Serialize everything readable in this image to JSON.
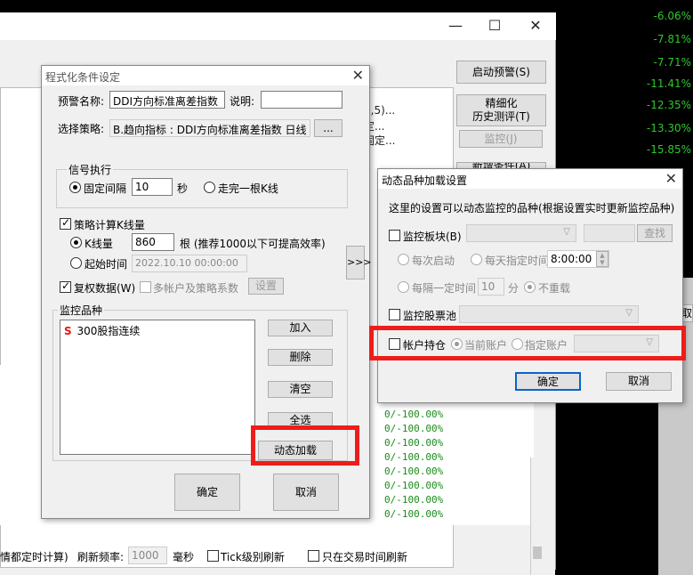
{
  "background": {
    "percentages": [
      "-6.06%",
      "-7.81%",
      "-7.71%",
      "-11.41%",
      "-12.35%",
      "-13.30%",
      "-15.85%"
    ],
    "right_buttons": [
      "启动预警(S)",
      "精细化\n历史测评(T)",
      "监控(J)",
      "新增条件(A)"
    ],
    "list_fragments": [
      "0,5)...",
      "定...",
      "固定..."
    ],
    "side_tab": "取",
    "green_values": [
      "0/-100.00%",
      "0/-100.00%",
      "0/-100.00%",
      "0/-100.00%",
      "0/-100.00%",
      "0/-100.00%",
      "0/-100.00%",
      "0/-100.00%",
      "0/-100.00%",
      "0/-100.00%"
    ],
    "bottom_bar": {
      "prefix": "情都定时计算)",
      "refresh_label": "刷新频率:",
      "refresh_value": "1000",
      "unit": "毫秒",
      "tick_label": "Tick级别刷新",
      "trade_time_label": "只在交易时间刷新"
    }
  },
  "dialog1": {
    "title": "程式化条件设定",
    "alert_name_label": "预警名称:",
    "alert_name_value": "DDI方向标准离差指数",
    "desc_label": "说明:",
    "desc_value": "",
    "strategy_label": "选择策略:",
    "strategy_value": "B.趋向指标 : DDI方向标准离差指数 日线",
    "browse_button": "...",
    "signal_group": "信号执行",
    "fixed_interval_label": "固定间隔",
    "fixed_interval_value": "10",
    "seconds_label": "秒",
    "finish_kline_label": "走完一根K线",
    "strategy_calc_label": "策略计算K线量",
    "kline_count_label": "K线量",
    "kline_count_value": "860",
    "kline_hint": "根 (推荐1000以下可提高效率)",
    "start_time_label": "起始时间",
    "start_time_value": "2022.10.10 00:00:00",
    "restore_rights_label": "复权数据(W)",
    "multi_account_label": "多帐户及策略系数",
    "settings_button": "设置",
    "monitor_group": "监控品种",
    "monitor_items": [
      {
        "tag": "S",
        "name": "300股指连续"
      }
    ],
    "add_button": "加入",
    "delete_button": "删除",
    "clear_button": "清空",
    "select_all_button": "全选",
    "dynamic_load_button": "动态加载",
    "ok_button": "确定",
    "cancel_button": "取消",
    "expand_button": ">>>"
  },
  "dialog2": {
    "title": "动态品种加载设置",
    "description": "这里的设置可以动态监控的品种(根据设置实时更新监控品种)",
    "monitor_block_label": "监控板块(B)",
    "find_button": "查找",
    "each_start_label": "每次启动",
    "daily_time_label": "每天指定时间",
    "daily_time_value": "8:00:00",
    "every_interval_label": "每隔一定时间",
    "interval_value": "10",
    "minutes_label": "分",
    "no_repeat_label": "不重载",
    "monitor_pool_label": "监控股票池",
    "account_position_label": "帐户持仓",
    "current_account_label": "当前账户",
    "specified_account_label": "指定账户",
    "ok_button": "确定",
    "cancel_button": "取消"
  }
}
